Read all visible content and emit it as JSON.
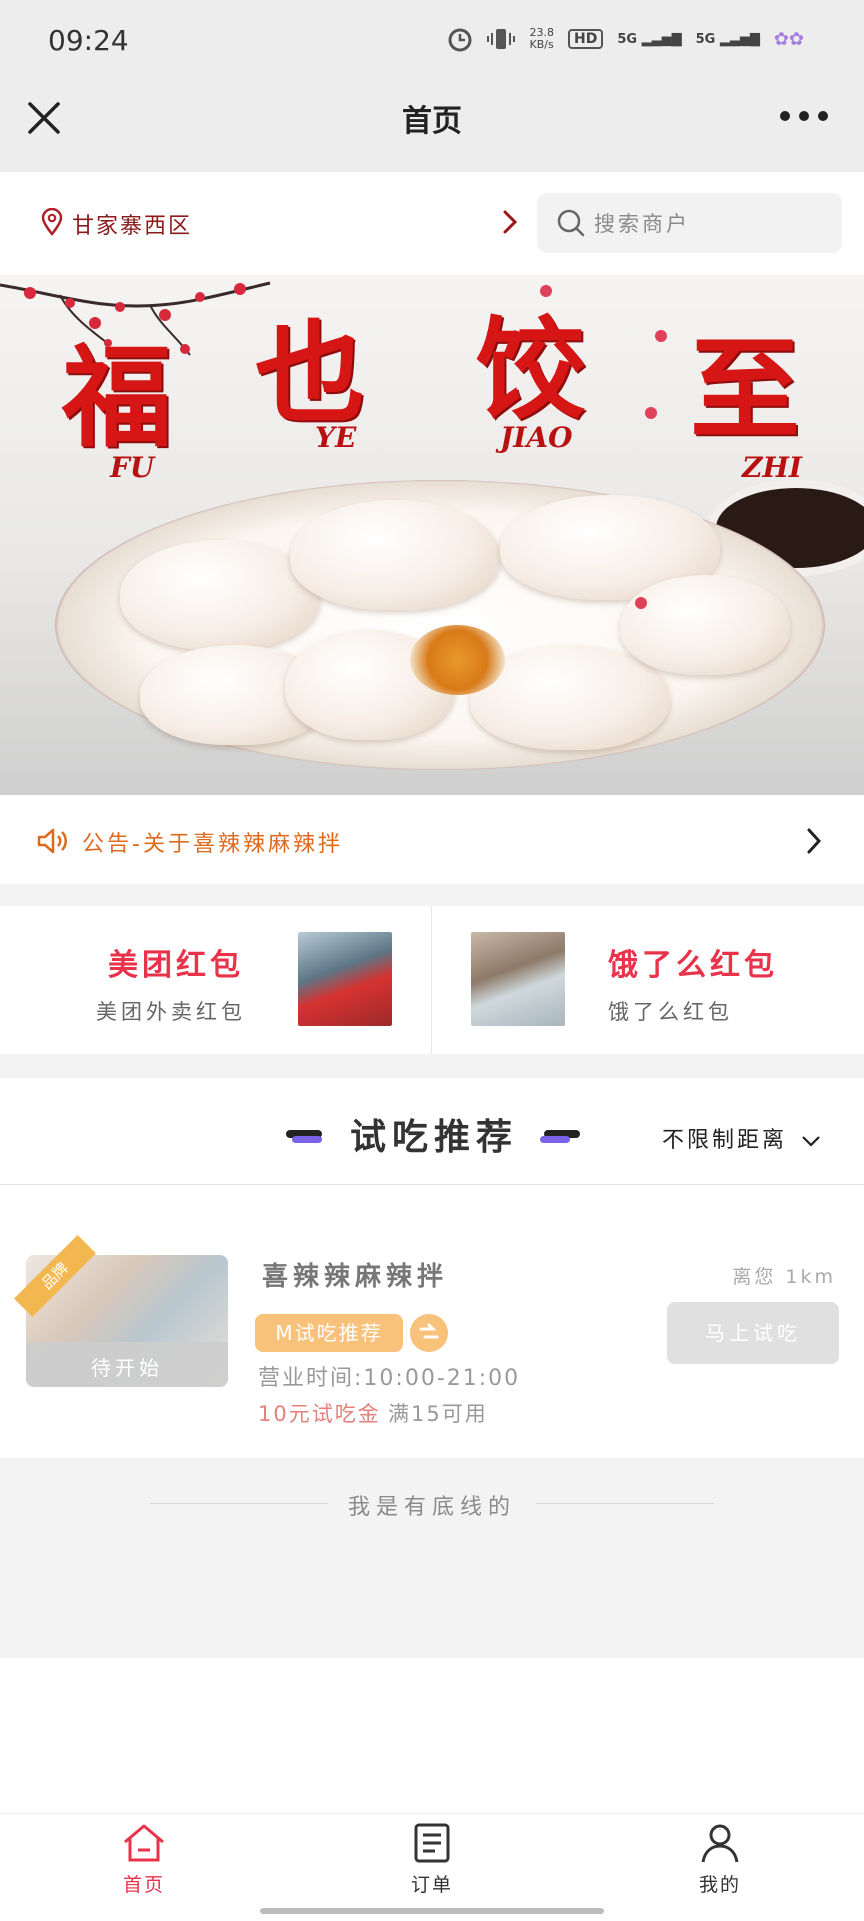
{
  "status_bar": {
    "time": "09:24",
    "net_speed": "23.8",
    "net_unit": "KB/s",
    "hd": "HD",
    "sim1": "5G",
    "sim2": "5G"
  },
  "header": {
    "title": "首页",
    "close_icon": "close-icon",
    "more_icon": "more-icon"
  },
  "location": {
    "district": "甘家寨西区",
    "search_placeholder": "搜索商户"
  },
  "banner": {
    "brand_chars": [
      "福",
      "也",
      "饺",
      "至"
    ],
    "brand_pinyin": [
      "FU",
      "YE",
      "JIAO",
      "ZHI"
    ]
  },
  "notice": {
    "text": "公告-关于喜辣辣麻辣拌"
  },
  "red_packets": [
    {
      "title": "美团红包",
      "subtitle": "美团外卖红包"
    },
    {
      "title": "饿了么红包",
      "subtitle": "饿了么红包"
    }
  ],
  "trial_section": {
    "title": "试吃推荐",
    "distance_filter": "不限制距离"
  },
  "trial_card": {
    "ribbon": "品牌",
    "status": "待开始",
    "shop_name": "喜辣辣麻辣拌",
    "tag": "M试吃推荐",
    "hours": "营业时间:10:00-21:00",
    "promo_highlight": "10元试吃金",
    "promo_rest": "满15可用",
    "distance": "离您 1km",
    "button": "马上试吃"
  },
  "footer_line": "我是有底线的",
  "tabs": [
    {
      "label": "首页",
      "icon": "home-icon",
      "active": true
    },
    {
      "label": "订单",
      "icon": "order-icon",
      "active": false
    },
    {
      "label": "我的",
      "icon": "profile-icon",
      "active": false
    }
  ],
  "colors": {
    "accent": "#e8334a",
    "notice": "#e06a1c",
    "tag": "#f9c27b",
    "brand_red": "#d61515"
  }
}
